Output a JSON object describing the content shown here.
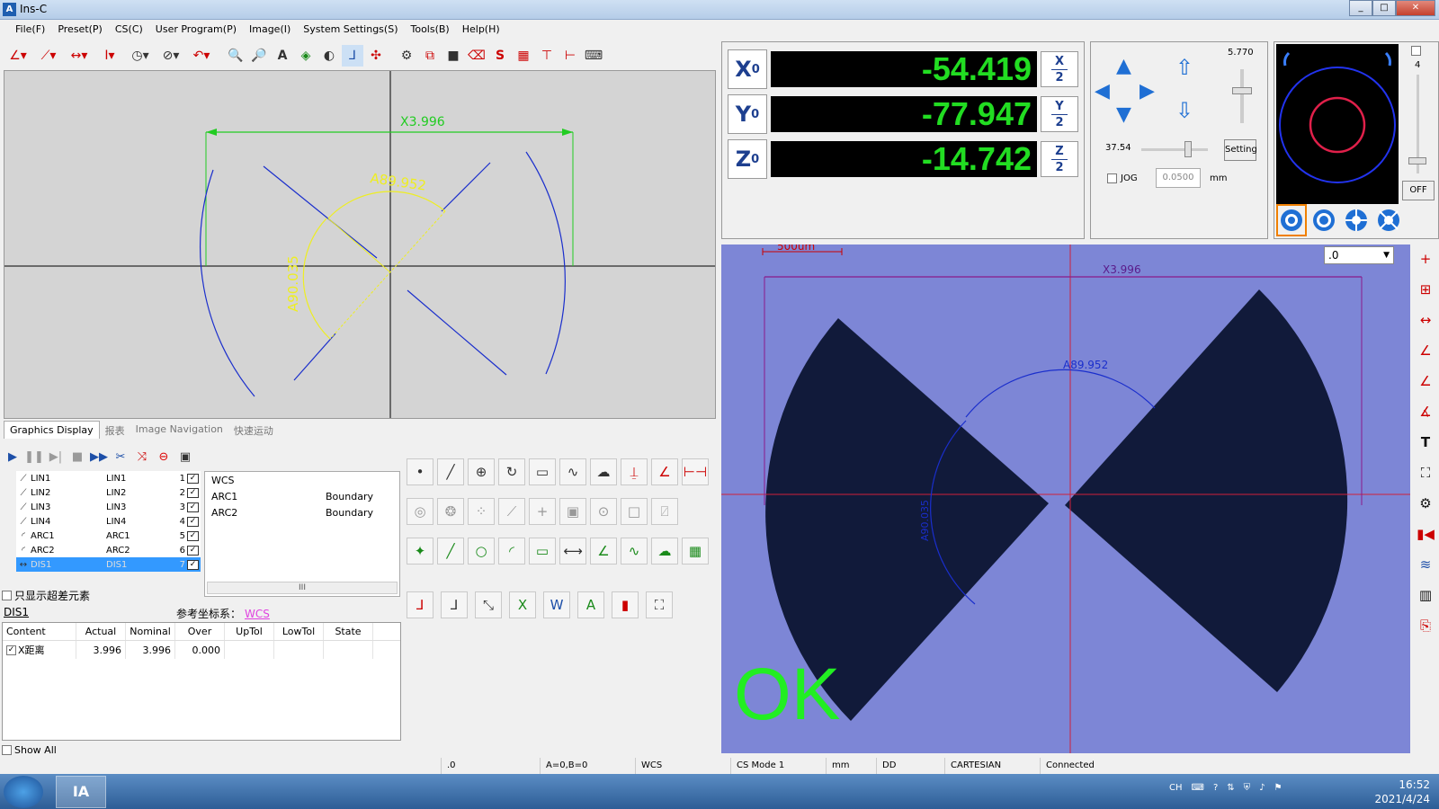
{
  "window": {
    "title": "Ins-C",
    "minimize": "_",
    "maximize": "□",
    "close": "✕"
  },
  "menu": [
    "File(F)",
    "Preset(P)",
    "CS(C)",
    "User Program(P)",
    "Image(I)",
    "System Settings(S)",
    "Tools(B)",
    "Help(H)"
  ],
  "graphics": {
    "x_dim": "X3.996",
    "angle1": "A89.952",
    "angle2": "A90.035"
  },
  "tabs": [
    "Graphics Display",
    "报表",
    "Image Navigation",
    "快速运动"
  ],
  "features": [
    {
      "name": "LIN1",
      "type": "LIN1",
      "num": "1",
      "icon": "line-icon"
    },
    {
      "name": "LIN2",
      "type": "LIN2",
      "num": "2",
      "icon": "line-icon"
    },
    {
      "name": "LIN3",
      "type": "LIN3",
      "num": "3",
      "icon": "line-icon"
    },
    {
      "name": "LIN4",
      "type": "LIN4",
      "num": "4",
      "icon": "line-icon"
    },
    {
      "name": "ARC1",
      "type": "ARC1",
      "num": "5",
      "icon": "arc-icon"
    },
    {
      "name": "ARC2",
      "type": "ARC2",
      "num": "6",
      "icon": "arc-icon"
    },
    {
      "name": "DIS1",
      "type": "DIS1",
      "num": "7",
      "icon": "distance-icon"
    }
  ],
  "reference": [
    {
      "name": "WCS",
      "mode": ""
    },
    {
      "name": "ARC1",
      "mode": "Boundary"
    },
    {
      "name": "ARC2",
      "mode": "Boundary"
    }
  ],
  "scroll_label": "III",
  "only_exceed_label": "只显示超差元素",
  "result": {
    "title": "DIS1",
    "ref_label": "参考坐标系：",
    "ref_value": "WCS",
    "columns": [
      "Content",
      "Actual",
      "Nominal",
      "Over",
      "UpTol",
      "LowTol",
      "State"
    ],
    "rows": [
      {
        "content": "X距离",
        "actual": "3.996",
        "nominal": "3.996",
        "over": "0.000",
        "uptol": "",
        "lowtol": "",
        "state": ""
      }
    ]
  },
  "show_all_label": "Show All",
  "dro": {
    "x": {
      "axis": "X",
      "sub": "0",
      "value": "-54.419",
      "half_top": "X",
      "half_bot": "2"
    },
    "y": {
      "axis": "Y",
      "sub": "0",
      "value": "-77.947",
      "half_top": "Y",
      "half_bot": "2"
    },
    "z": {
      "axis": "Z",
      "sub": "0",
      "value": "-14.742",
      "half_top": "Z",
      "half_bot": "2"
    }
  },
  "motion": {
    "z_speed": "5.770",
    "xy_speed": "37.54",
    "setting_label": "Setting",
    "jog_label": "JOG",
    "step_value": "0.0500",
    "unit": "mm"
  },
  "light": {
    "level": "4",
    "off_label": "OFF"
  },
  "camera": {
    "scale_label": "500um",
    "x_dim": "X3.996",
    "angle": "A89.952",
    "angle2": "A90.035",
    "result": "OK",
    "dropdown": ".0"
  },
  "status": [
    ".0",
    "A=0,B=0",
    "WCS",
    "CS Mode 1",
    "mm",
    "DD",
    "CARTESIAN",
    "Connected"
  ],
  "tray": {
    "lang": "CH",
    "time": "16:52",
    "date": "2021/4/24"
  },
  "taskbar_app": "IA"
}
